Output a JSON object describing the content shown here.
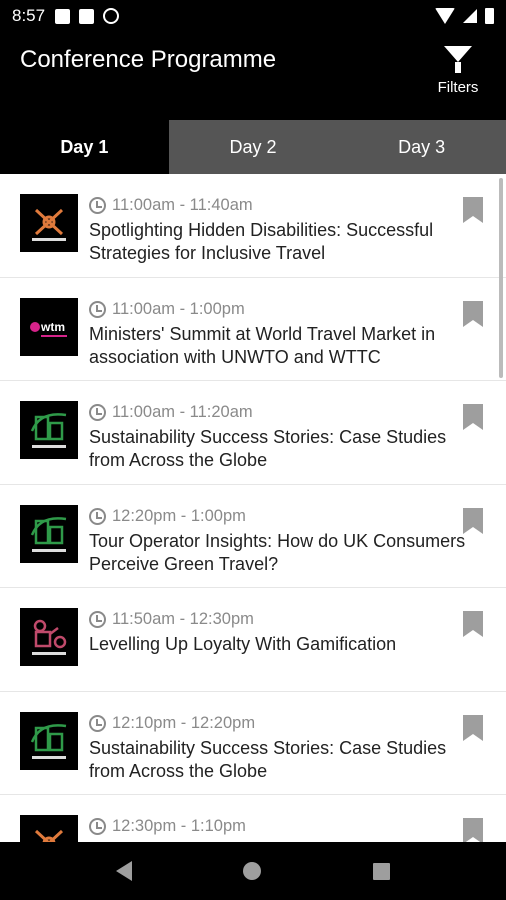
{
  "status_bar": {
    "time": "8:57"
  },
  "app_bar": {
    "title": "Conference Programme",
    "filters_label": "Filters"
  },
  "tabs": [
    {
      "label": "Day 1",
      "active": true
    },
    {
      "label": "Day 2",
      "active": false
    },
    {
      "label": "Day 3",
      "active": false
    }
  ],
  "sessions": [
    {
      "time": "11:00am - 11:40am",
      "title": "Spotlighting Hidden Disabilities: Successful Strategies for Inclusive Travel",
      "track_icon": "diversity-inclusion-track",
      "track_color": "#e07a3c"
    },
    {
      "time": "11:00am - 1:00pm",
      "title": "Ministers' Summit at World Travel Market in association with UNWTO and WTTC",
      "track_icon": "wtm-logo",
      "track_color": "#d6238a"
    },
    {
      "time": "11:00am - 11:20am",
      "title": "Sustainability Success Stories: Case Studies from Across the Globe",
      "track_icon": "sustainability-track",
      "track_color": "#2f9a49"
    },
    {
      "time": "12:20pm - 1:00pm",
      "title": "Tour Operator Insights: How do UK Consumers Perceive Green Travel?",
      "track_icon": "sustainability-track",
      "track_color": "#2f9a49"
    },
    {
      "time": "11:50am - 12:30pm",
      "title": "Levelling Up Loyalty With Gamification",
      "track_icon": "marketing-track",
      "track_color": "#c04a6b"
    },
    {
      "time": "12:10pm - 12:20pm",
      "title": "Sustainability Success Stories: Case Studies from Across the Globe",
      "track_icon": "sustainability-track",
      "track_color": "#2f9a49"
    },
    {
      "time": "12:30pm - 1:10pm",
      "title": "",
      "track_icon": "diversity-inclusion-track",
      "track_color": "#e07a3c"
    }
  ]
}
